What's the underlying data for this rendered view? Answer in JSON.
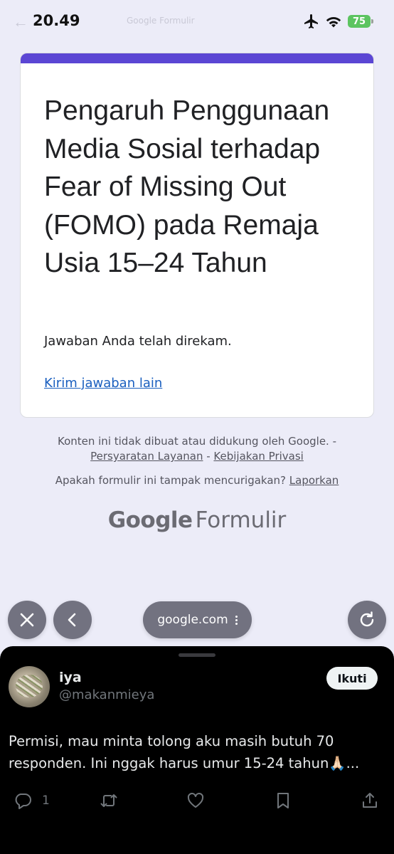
{
  "status_bar": {
    "time": "20.49",
    "ghost_text": "Google Formulir",
    "battery": "75"
  },
  "form": {
    "title": "Pengaruh Penggunaan Media Sosial terhadap Fear of Missing Out (FOMO) pada Remaja Usia 15–24 Tahun",
    "response_message": "Jawaban Anda telah direkam.",
    "another_response_link": "Kirim jawaban lain",
    "accent_color": "#5b46d4"
  },
  "footer": {
    "disclaimer_text": "Konten ini tidak dibuat atau didukung oleh Google. - ",
    "terms_link": "Persyaratan Layanan",
    "separator": " - ",
    "privacy_link": "Kebijakan Privasi",
    "report_question": "Apakah formulir ini tampak mencurigakan? ",
    "report_link": "Laporkan",
    "brand_google": "Google",
    "brand_product": "Formulir"
  },
  "browser": {
    "url": "google.com"
  },
  "tweet": {
    "display_name": "iya",
    "handle": "@makanmieya",
    "follow_label": "Ikuti",
    "text": "Permisi, mau minta tolong aku masih butuh 70 responden. Ini nggak harus umur 15-24 tahun🙏🏻...",
    "reply_count": "1"
  },
  "icons": {
    "status": [
      "back-arrow-icon",
      "airplane-icon",
      "wifi-icon",
      "battery-icon"
    ],
    "browser": [
      "close-icon",
      "chevron-left-icon",
      "more-vertical-icon",
      "reload-icon"
    ],
    "tweet_actions": [
      "reply-icon",
      "retweet-icon",
      "heart-icon",
      "bookmark-icon",
      "share-icon"
    ]
  }
}
